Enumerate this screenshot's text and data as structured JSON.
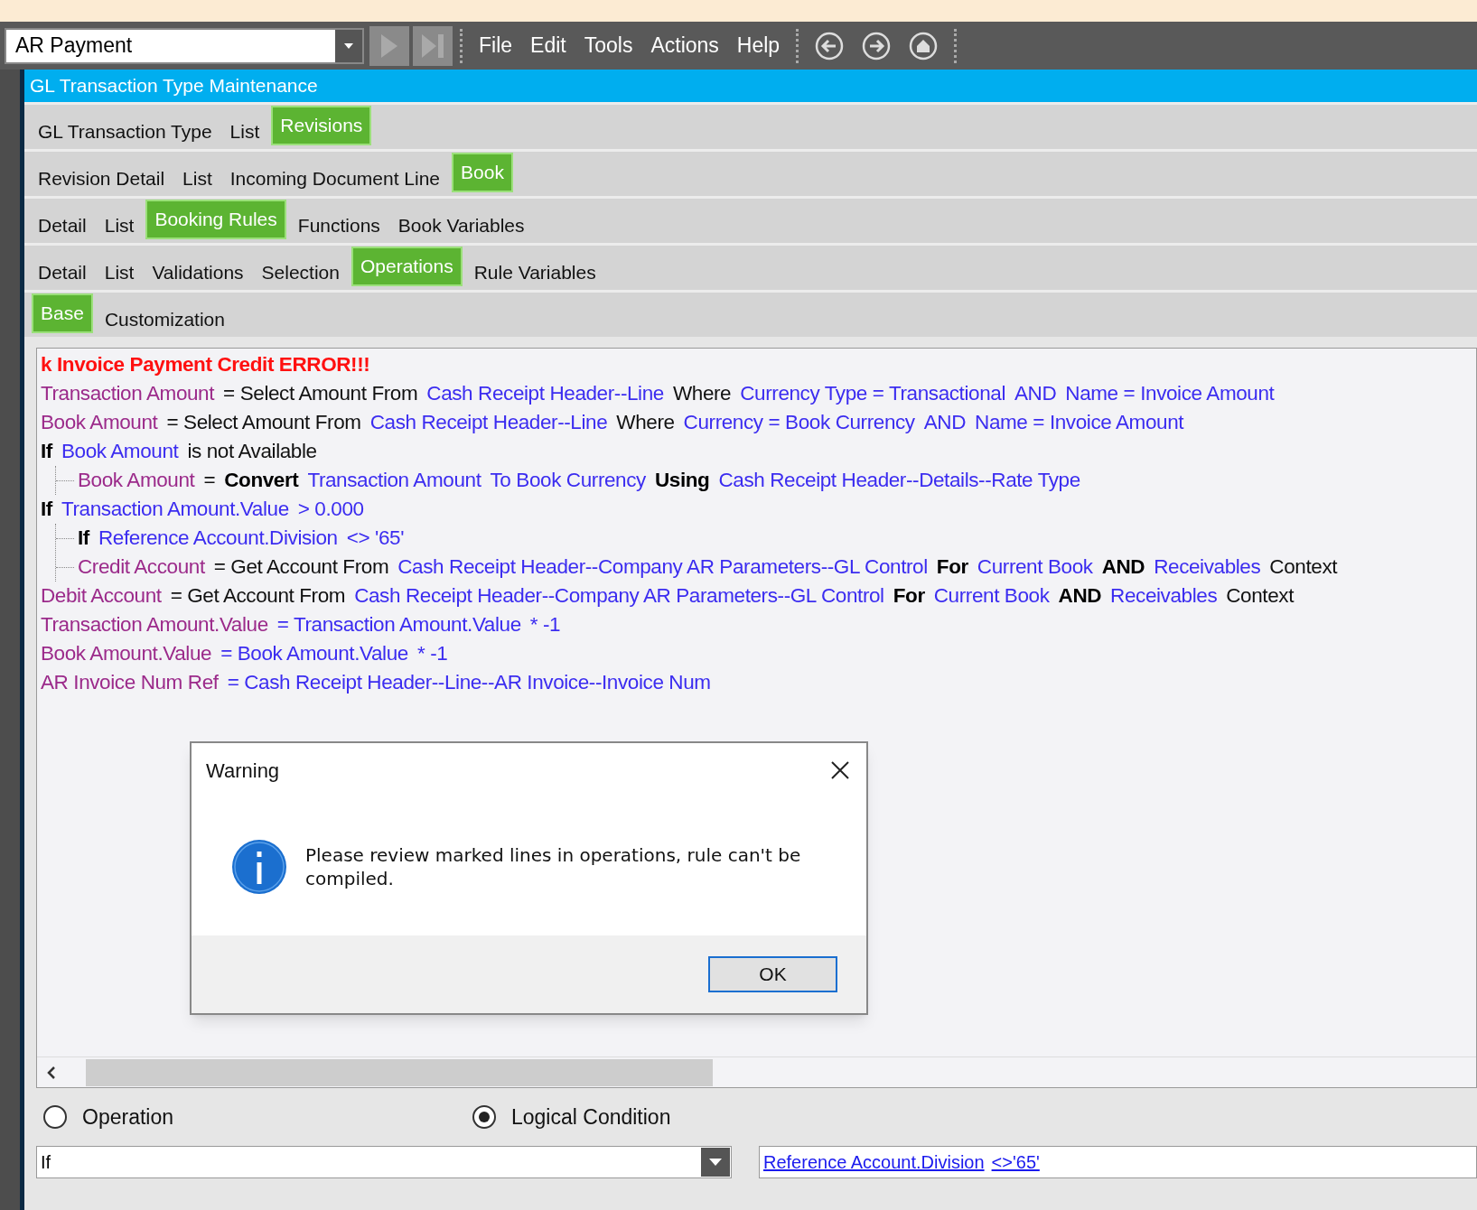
{
  "toolbar": {
    "module_field": {
      "value": "AR Payment"
    },
    "menu": [
      "File",
      "Edit",
      "Tools",
      "Actions",
      "Help"
    ]
  },
  "title_bar": {
    "title": "GL Transaction Type Maintenance"
  },
  "tab_rows": [
    [
      {
        "label": "GL Transaction Type",
        "selected": false
      },
      {
        "label": "List",
        "selected": false
      },
      {
        "label": "Revisions",
        "selected": true
      }
    ],
    [
      {
        "label": "Revision Detail",
        "selected": false
      },
      {
        "label": "List",
        "selected": false
      },
      {
        "label": "Incoming Document Line",
        "selected": false
      },
      {
        "label": "Book",
        "selected": true
      }
    ],
    [
      {
        "label": "Detail",
        "selected": false
      },
      {
        "label": "List",
        "selected": false
      },
      {
        "label": "Booking Rules",
        "selected": true
      },
      {
        "label": "Functions",
        "selected": false
      },
      {
        "label": "Book Variables",
        "selected": false
      }
    ],
    [
      {
        "label": "Detail",
        "selected": false
      },
      {
        "label": "List",
        "selected": false
      },
      {
        "label": "Validations",
        "selected": false
      },
      {
        "label": "Selection",
        "selected": false
      },
      {
        "label": "Operations",
        "selected": true
      },
      {
        "label": "Rule Variables",
        "selected": false
      }
    ],
    [
      {
        "label": "Base",
        "selected": true
      },
      {
        "label": "Customization",
        "selected": false
      }
    ]
  ],
  "operations": {
    "lines": [
      {
        "tokens": [
          {
            "kind": "error",
            "text": "k Invoice Payment Credit ERROR!!!"
          }
        ]
      },
      {
        "tokens": [
          {
            "kind": "var",
            "text": "Transaction Amount"
          },
          {
            "kind": "plain",
            "text": "= Select Amount From"
          },
          {
            "kind": "ref",
            "text": "Cash Receipt Header--Line"
          },
          {
            "kind": "plain",
            "text": "Where"
          },
          {
            "kind": "ref",
            "text": "Currency Type = Transactional"
          },
          {
            "kind": "ref",
            "text": "AND"
          },
          {
            "kind": "ref",
            "text": "Name = Invoice Amount"
          }
        ]
      },
      {
        "tokens": [
          {
            "kind": "var",
            "text": "Book Amount"
          },
          {
            "kind": "plain",
            "text": "= Select Amount From"
          },
          {
            "kind": "ref",
            "text": "Cash Receipt Header--Line"
          },
          {
            "kind": "plain",
            "text": "Where"
          },
          {
            "kind": "ref",
            "text": "Currency = Book Currency"
          },
          {
            "kind": "ref",
            "text": "AND"
          },
          {
            "kind": "ref",
            "text": "Name = Invoice Amount"
          }
        ]
      },
      {
        "tokens": [
          {
            "kind": "keyword",
            "text": "If"
          },
          {
            "kind": "ref",
            "text": "Book Amount"
          },
          {
            "kind": "plain",
            "text": "is not Available"
          }
        ],
        "children": [
          {
            "tokens": [
              {
                "kind": "var",
                "text": "Book Amount"
              },
              {
                "kind": "plain",
                "text": "="
              },
              {
                "kind": "keyword",
                "text": "Convert"
              },
              {
                "kind": "ref",
                "text": "Transaction Amount"
              },
              {
                "kind": "ref",
                "text": "To Book Currency"
              },
              {
                "kind": "keyword",
                "text": "Using"
              },
              {
                "kind": "ref",
                "text": "Cash Receipt Header--Details--Rate Type"
              }
            ]
          }
        ]
      },
      {
        "tokens": [
          {
            "kind": "keyword",
            "text": "If"
          },
          {
            "kind": "ref",
            "text": "Transaction Amount.Value"
          },
          {
            "kind": "ref",
            "text": "> 0.000"
          }
        ],
        "children": [
          {
            "tokens": [
              {
                "kind": "keyword",
                "text": "If"
              },
              {
                "kind": "ref",
                "text": "Reference Account.Division"
              },
              {
                "kind": "ref",
                "text": "<> '65'"
              }
            ]
          },
          {
            "tokens": [
              {
                "kind": "var",
                "text": "Credit Account"
              },
              {
                "kind": "plain",
                "text": "= Get Account From"
              },
              {
                "kind": "ref",
                "text": "Cash Receipt Header--Company AR Parameters--GL Control"
              },
              {
                "kind": "keyword",
                "text": "For"
              },
              {
                "kind": "ref",
                "text": "Current Book"
              },
              {
                "kind": "keyword",
                "text": "AND"
              },
              {
                "kind": "ref",
                "text": "Receivables"
              },
              {
                "kind": "plain",
                "text": "Context"
              }
            ]
          }
        ]
      },
      {
        "tokens": [
          {
            "kind": "var",
            "text": "Debit Account"
          },
          {
            "kind": "plain",
            "text": "= Get Account From"
          },
          {
            "kind": "ref",
            "text": "Cash Receipt Header--Company AR Parameters--GL Control"
          },
          {
            "kind": "keyword",
            "text": "For"
          },
          {
            "kind": "ref",
            "text": "Current Book"
          },
          {
            "kind": "keyword",
            "text": "AND"
          },
          {
            "kind": "ref",
            "text": "Receivables"
          },
          {
            "kind": "plain",
            "text": "Context"
          }
        ]
      },
      {
        "tokens": [
          {
            "kind": "var",
            "text": "Transaction Amount.Value"
          },
          {
            "kind": "ref",
            "text": "= Transaction Amount.Value"
          },
          {
            "kind": "ref",
            "text": "* -1"
          }
        ]
      },
      {
        "tokens": [
          {
            "kind": "var",
            "text": "Book Amount.Value"
          },
          {
            "kind": "ref",
            "text": "= Book Amount.Value"
          },
          {
            "kind": "ref",
            "text": "* -1"
          }
        ]
      },
      {
        "tokens": [
          {
            "kind": "var",
            "text": "AR Invoice Num Ref"
          },
          {
            "kind": "ref",
            "text": "= Cash Receipt Header--Line--AR Invoice--Invoice Num"
          }
        ]
      }
    ]
  },
  "dialog": {
    "title": "Warning",
    "message": "Please review marked lines in operations, rule can't be compiled.",
    "button": "OK"
  },
  "condition_type": [
    {
      "label": "Operation",
      "selected": false
    },
    {
      "label": "Logical Condition",
      "selected": true
    }
  ],
  "statement_field": {
    "value": "If"
  },
  "expression_field": {
    "tokens": [
      "Reference Account.Division",
      "<>'65'"
    ]
  }
}
